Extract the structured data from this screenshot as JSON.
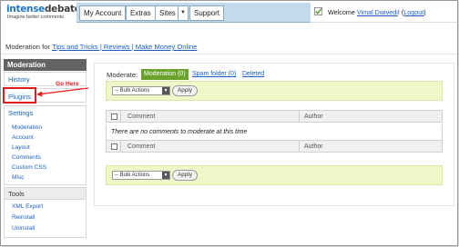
{
  "header": {
    "logo_part1": "intense",
    "logo_part2": "debate",
    "logo_tagline": "Imagine better comments",
    "nav": {
      "my_account": "My Account",
      "extras": "Extras",
      "sites": "Sites",
      "sites_arrow": "▼",
      "support": "Support"
    },
    "welcome_prefix": "Welcome ",
    "user_name": "Vimal Dwivedi",
    "welcome_mid": "! (",
    "logout": "Logout",
    "welcome_suffix": ")"
  },
  "subheader": {
    "prefix": "Moderation for ",
    "site_link": "Tips and Tricks | Reviews | Make Money Online"
  },
  "sidebar": {
    "moderation_header": "Moderation",
    "history": "History",
    "plugins": "Plugins",
    "settings": "Settings",
    "settings_items": [
      "Moderation",
      "Account",
      "Layout",
      "Comments",
      "Custom CSS",
      "Misc"
    ],
    "tools": "Tools",
    "tools_items": [
      "XML Export",
      "Reinstall",
      "Uninstall"
    ]
  },
  "annotation": {
    "go_here": "Go Here",
    "color": "#e21b1b"
  },
  "main": {
    "moderate_label": "Moderate:",
    "tab_moderation": "Moderation (0)",
    "tab_spam": "Spam folder (0)",
    "tab_deleted": "Deleted",
    "bulk_actions": "-- Bulk Actions",
    "apply": "Apply",
    "col_comment": "Comment",
    "col_author": "Author",
    "empty_message": "There are no comments to moderate at this time"
  },
  "colors": {
    "brand_blue": "#1b76c6",
    "tab_green": "#6aa32b",
    "toolbar_yellow": "#eff7c9",
    "sidebar_header": "#636363",
    "link": "#1a5fc4"
  }
}
